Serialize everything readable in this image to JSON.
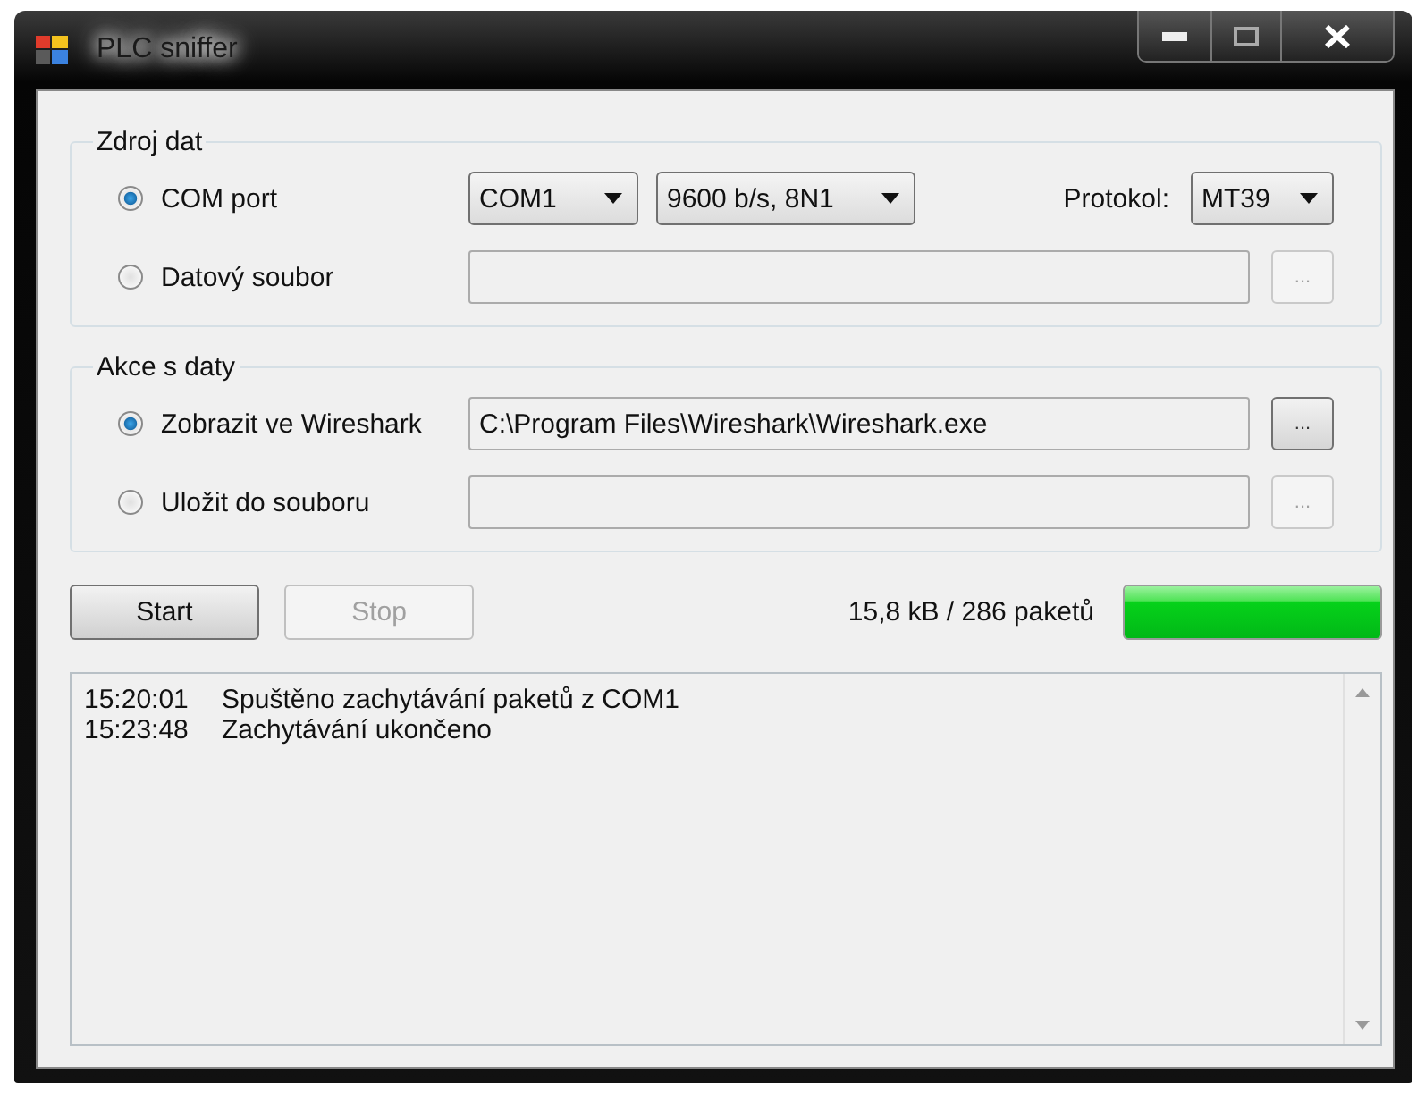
{
  "window": {
    "title": "PLC sniffer"
  },
  "groups": [
    {
      "title": "Zdroj dat",
      "options": [
        {
          "kind": "serial",
          "label": "COM port",
          "selected": true,
          "port": "COM1",
          "speed": "9600 b/s, 8N1",
          "protocol_label": "Protokol:",
          "protocol": "MT39"
        },
        {
          "kind": "file",
          "label": "Datový soubor",
          "selected": false,
          "browse": {
            "label": "...",
            "disabled": true
          }
        }
      ]
    },
    {
      "title": "Akce s daty",
      "options": [
        {
          "kind": "file",
          "label": "Zobrazit ve Wireshark",
          "selected": true,
          "path": "C:\\Program Files\\Wireshark\\Wireshark.exe",
          "browse": {
            "label": "...",
            "disabled": false
          }
        },
        {
          "kind": "file",
          "label": "Uložit do souboru",
          "selected": false,
          "browse": {
            "label": "...",
            "disabled": true
          }
        }
      ]
    }
  ],
  "buttons": [
    {
      "label": "Start",
      "disabled": false
    },
    {
      "label": "Stop",
      "disabled": true
    }
  ],
  "status": "15,8 kB / 286 paketů",
  "progress": {
    "level": 1
  },
  "log": [
    {
      "time": "15:20:01",
      "message": "Spuštěno zachytávání paketů z COM1"
    },
    {
      "time": "15:23:48",
      "message": "Zachytávání ukončeno"
    }
  ]
}
